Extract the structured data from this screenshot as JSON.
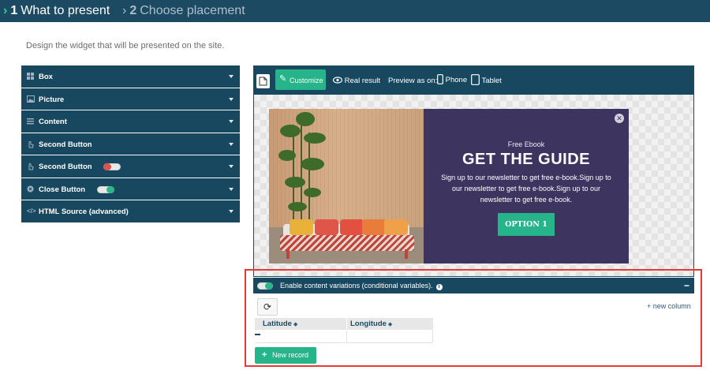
{
  "steps": [
    {
      "number": "1",
      "label": "What to present",
      "active": true
    },
    {
      "number": "2",
      "label": "Choose placement",
      "active": false
    }
  ],
  "subtitle": "Design the widget that will be presented on the site.",
  "design_panel": {
    "items": [
      {
        "label": "Box",
        "icon": "grid-icon"
      },
      {
        "label": "Picture",
        "icon": "picture-icon"
      },
      {
        "label": "Content",
        "icon": "lines-icon"
      },
      {
        "label": "Second Button",
        "icon": "hand-icon"
      },
      {
        "label": "Second Button",
        "icon": "hand-icon",
        "toggle": "off"
      },
      {
        "label": "Close Button",
        "icon": "close-circle-icon",
        "toggle": "on"
      },
      {
        "label": "HTML Source (advanced)",
        "icon": "code-icon"
      }
    ]
  },
  "preview_toolbar": {
    "customize_label": "Customize",
    "real_result_label": "Real result",
    "preview_as_label": "Preview as on:",
    "phone_label": "Phone",
    "tablet_label": "Tablet"
  },
  "widget": {
    "eyebrow": "Free Ebook",
    "headline": "GET THE GUIDE",
    "body": "Sign up to our newsletter to get free e-book.Sign up to our newsletter to get free e-book.Sign up to our newsletter to get free e-book.",
    "cta_label": "OPTION 1",
    "background_color": "#3d3460",
    "cta_color": "#26b48b"
  },
  "variations": {
    "toggle_label": "Enable content variations (conditional variables).",
    "new_column_label": "+ new column",
    "columns": [
      "Latitude",
      "Longitude"
    ],
    "new_record_label": "New record"
  },
  "colors": {
    "primary_dark": "#17485f",
    "accent": "#26b48b",
    "highlight": "#e53935"
  }
}
